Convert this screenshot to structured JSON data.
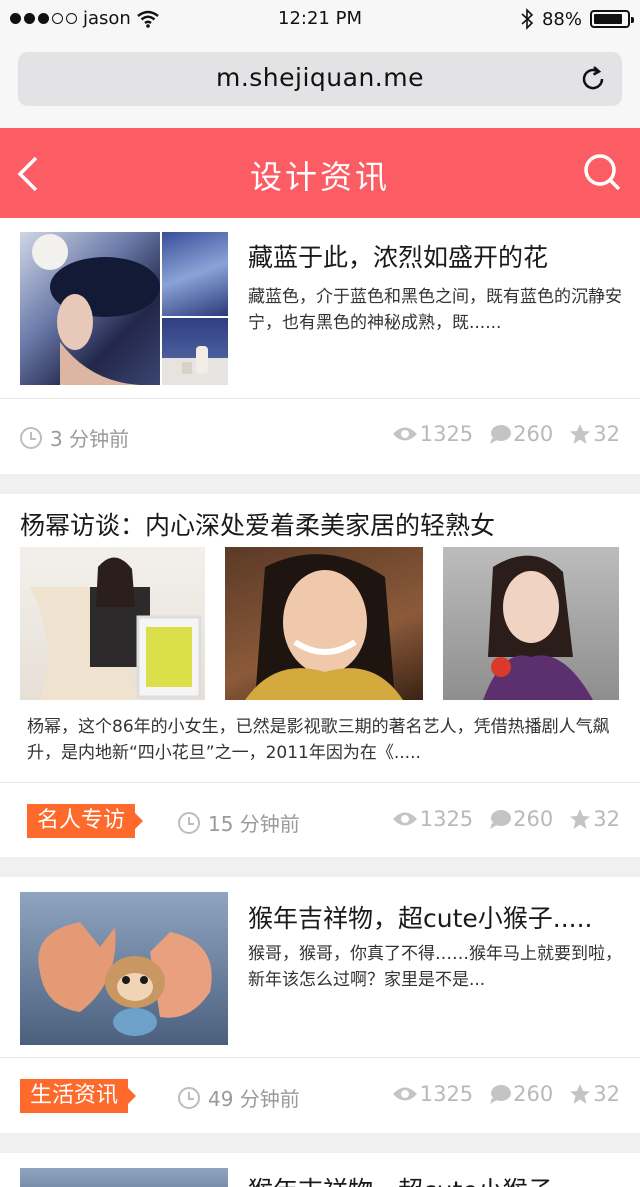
{
  "status_bar": {
    "carrier": "jason",
    "time": "12:21 PM",
    "battery": "88%",
    "battery_level": 0.88
  },
  "browser": {
    "url": "m.shejiquan.me"
  },
  "nav": {
    "title": "设计资讯"
  },
  "articles": [
    {
      "title": "藏蓝于此，浓烈如盛开的花",
      "desc": "藏蓝色，介于蓝色和黑色之间，既有蓝色的沉静安宁，也有黑色的神秘成熟，既......",
      "time": "3 分钟前",
      "views": "1325",
      "comments": "260",
      "stars": "32"
    },
    {
      "title": "杨幂访谈：内心深处爱着柔美家居的轻熟女",
      "desc": "杨幂，这个86年的小女生，已然是影视歌三期的著名艺人，凭借热播剧人气飙升，是内地新“四小花旦”之一，2011年因为在《.....",
      "tag": "名人专访",
      "time": "15 分钟前",
      "views": "1325",
      "comments": "260",
      "stars": "32"
    },
    {
      "title": "猴年吉祥物，超cute小猴子.....",
      "desc": "猴哥，猴哥，你真了不得……猴年马上就要到啦，新年该怎么过啊？家里是不是...",
      "tag": "生活资讯",
      "time": "49 分钟前",
      "views": "1325",
      "comments": "260",
      "stars": "32"
    },
    {
      "title": "猴年吉祥物，超cute小猴子....."
    }
  ],
  "colors": {
    "brand": "#fc5c64",
    "tag": "#fd6a2c"
  }
}
